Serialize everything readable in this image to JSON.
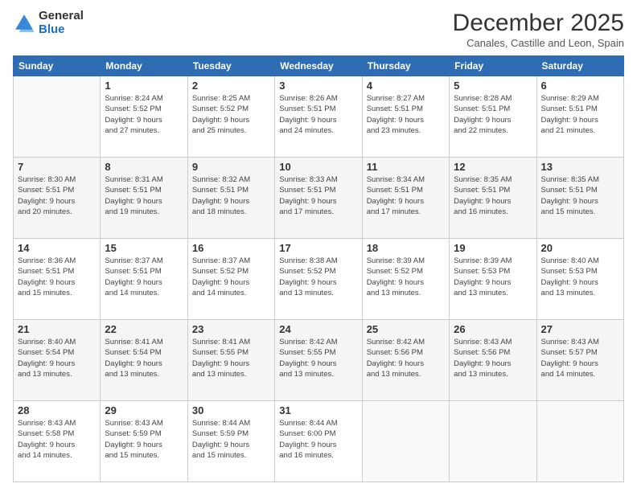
{
  "logo": {
    "general": "General",
    "blue": "Blue"
  },
  "title": "December 2025",
  "subtitle": "Canales, Castille and Leon, Spain",
  "days_header": [
    "Sunday",
    "Monday",
    "Tuesday",
    "Wednesday",
    "Thursday",
    "Friday",
    "Saturday"
  ],
  "weeks": [
    [
      {
        "day": "",
        "info": ""
      },
      {
        "day": "1",
        "info": "Sunrise: 8:24 AM\nSunset: 5:52 PM\nDaylight: 9 hours\nand 27 minutes."
      },
      {
        "day": "2",
        "info": "Sunrise: 8:25 AM\nSunset: 5:52 PM\nDaylight: 9 hours\nand 25 minutes."
      },
      {
        "day": "3",
        "info": "Sunrise: 8:26 AM\nSunset: 5:51 PM\nDaylight: 9 hours\nand 24 minutes."
      },
      {
        "day": "4",
        "info": "Sunrise: 8:27 AM\nSunset: 5:51 PM\nDaylight: 9 hours\nand 23 minutes."
      },
      {
        "day": "5",
        "info": "Sunrise: 8:28 AM\nSunset: 5:51 PM\nDaylight: 9 hours\nand 22 minutes."
      },
      {
        "day": "6",
        "info": "Sunrise: 8:29 AM\nSunset: 5:51 PM\nDaylight: 9 hours\nand 21 minutes."
      }
    ],
    [
      {
        "day": "7",
        "info": "Sunrise: 8:30 AM\nSunset: 5:51 PM\nDaylight: 9 hours\nand 20 minutes."
      },
      {
        "day": "8",
        "info": "Sunrise: 8:31 AM\nSunset: 5:51 PM\nDaylight: 9 hours\nand 19 minutes."
      },
      {
        "day": "9",
        "info": "Sunrise: 8:32 AM\nSunset: 5:51 PM\nDaylight: 9 hours\nand 18 minutes."
      },
      {
        "day": "10",
        "info": "Sunrise: 8:33 AM\nSunset: 5:51 PM\nDaylight: 9 hours\nand 17 minutes."
      },
      {
        "day": "11",
        "info": "Sunrise: 8:34 AM\nSunset: 5:51 PM\nDaylight: 9 hours\nand 17 minutes."
      },
      {
        "day": "12",
        "info": "Sunrise: 8:35 AM\nSunset: 5:51 PM\nDaylight: 9 hours\nand 16 minutes."
      },
      {
        "day": "13",
        "info": "Sunrise: 8:35 AM\nSunset: 5:51 PM\nDaylight: 9 hours\nand 15 minutes."
      }
    ],
    [
      {
        "day": "14",
        "info": "Sunrise: 8:36 AM\nSunset: 5:51 PM\nDaylight: 9 hours\nand 15 minutes."
      },
      {
        "day": "15",
        "info": "Sunrise: 8:37 AM\nSunset: 5:51 PM\nDaylight: 9 hours\nand 14 minutes."
      },
      {
        "day": "16",
        "info": "Sunrise: 8:37 AM\nSunset: 5:52 PM\nDaylight: 9 hours\nand 14 minutes."
      },
      {
        "day": "17",
        "info": "Sunrise: 8:38 AM\nSunset: 5:52 PM\nDaylight: 9 hours\nand 13 minutes."
      },
      {
        "day": "18",
        "info": "Sunrise: 8:39 AM\nSunset: 5:52 PM\nDaylight: 9 hours\nand 13 minutes."
      },
      {
        "day": "19",
        "info": "Sunrise: 8:39 AM\nSunset: 5:53 PM\nDaylight: 9 hours\nand 13 minutes."
      },
      {
        "day": "20",
        "info": "Sunrise: 8:40 AM\nSunset: 5:53 PM\nDaylight: 9 hours\nand 13 minutes."
      }
    ],
    [
      {
        "day": "21",
        "info": "Sunrise: 8:40 AM\nSunset: 5:54 PM\nDaylight: 9 hours\nand 13 minutes."
      },
      {
        "day": "22",
        "info": "Sunrise: 8:41 AM\nSunset: 5:54 PM\nDaylight: 9 hours\nand 13 minutes."
      },
      {
        "day": "23",
        "info": "Sunrise: 8:41 AM\nSunset: 5:55 PM\nDaylight: 9 hours\nand 13 minutes."
      },
      {
        "day": "24",
        "info": "Sunrise: 8:42 AM\nSunset: 5:55 PM\nDaylight: 9 hours\nand 13 minutes."
      },
      {
        "day": "25",
        "info": "Sunrise: 8:42 AM\nSunset: 5:56 PM\nDaylight: 9 hours\nand 13 minutes."
      },
      {
        "day": "26",
        "info": "Sunrise: 8:43 AM\nSunset: 5:56 PM\nDaylight: 9 hours\nand 13 minutes."
      },
      {
        "day": "27",
        "info": "Sunrise: 8:43 AM\nSunset: 5:57 PM\nDaylight: 9 hours\nand 14 minutes."
      }
    ],
    [
      {
        "day": "28",
        "info": "Sunrise: 8:43 AM\nSunset: 5:58 PM\nDaylight: 9 hours\nand 14 minutes."
      },
      {
        "day": "29",
        "info": "Sunrise: 8:43 AM\nSunset: 5:59 PM\nDaylight: 9 hours\nand 15 minutes."
      },
      {
        "day": "30",
        "info": "Sunrise: 8:44 AM\nSunset: 5:59 PM\nDaylight: 9 hours\nand 15 minutes."
      },
      {
        "day": "31",
        "info": "Sunrise: 8:44 AM\nSunset: 6:00 PM\nDaylight: 9 hours\nand 16 minutes."
      },
      {
        "day": "",
        "info": ""
      },
      {
        "day": "",
        "info": ""
      },
      {
        "day": "",
        "info": ""
      }
    ]
  ]
}
